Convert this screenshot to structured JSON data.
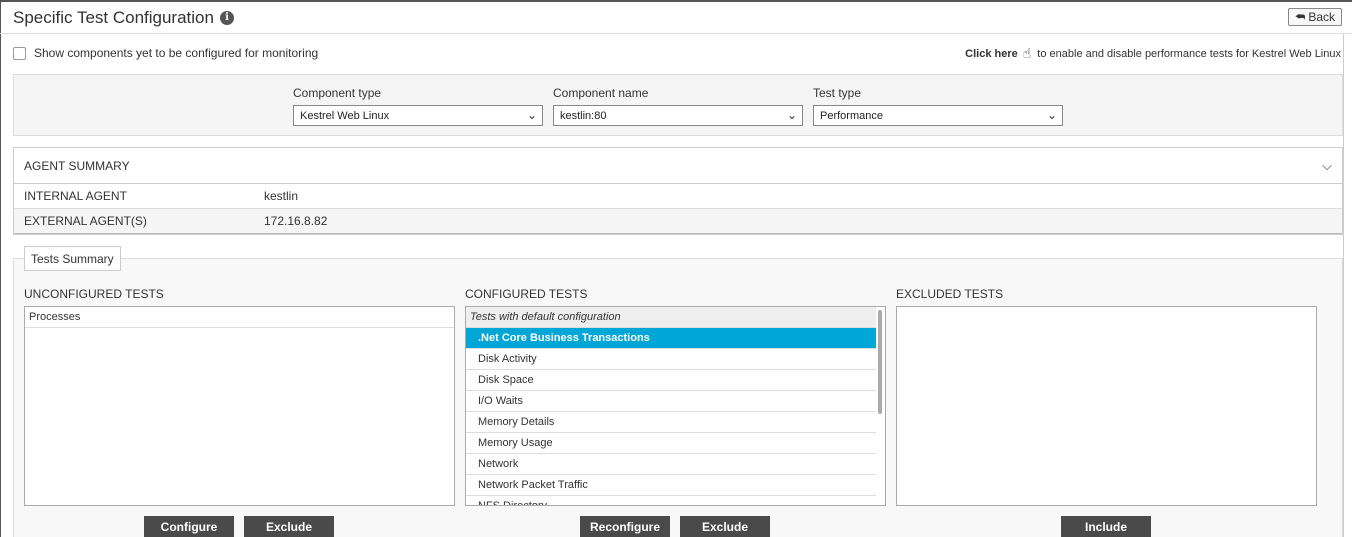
{
  "header": {
    "title": "Specific Test Configuration",
    "back_label": "Back"
  },
  "options": {
    "show_unconfigured_label": "Show components yet to be configured for monitoring",
    "click_here_label": "Click here",
    "click_here_text": "to enable and disable performance tests for Kestrel Web Linux"
  },
  "filters": {
    "component_type": {
      "label": "Component type",
      "value": "Kestrel Web Linux"
    },
    "component_name": {
      "label": "Component name",
      "value": "kestlin:80"
    },
    "test_type": {
      "label": "Test type",
      "value": "Performance"
    }
  },
  "agent_summary": {
    "title": "AGENT SUMMARY",
    "rows": [
      {
        "key": "INTERNAL AGENT",
        "value": "kestlin"
      },
      {
        "key": "EXTERNAL AGENT(S)",
        "value": "172.16.8.82"
      }
    ]
  },
  "tests_summary": {
    "tab_label": "Tests Summary",
    "unconfigured": {
      "label": "UNCONFIGURED TESTS",
      "items": [
        "Processes"
      ],
      "buttons": [
        "Configure",
        "Exclude"
      ]
    },
    "configured": {
      "label": "CONFIGURED TESTS",
      "group_label": "Tests with default configuration",
      "items": [
        ".Net Core Business Transactions",
        "Disk Activity",
        "Disk Space",
        "I/O Waits",
        "Memory Details",
        "Memory Usage",
        "Network",
        "Network Packet Traffic",
        "NFS Directory"
      ],
      "selected_index": 0,
      "buttons": [
        "Reconfigure",
        "Exclude"
      ]
    },
    "excluded": {
      "label": "EXCLUDED TESTS",
      "items": [],
      "buttons": [
        "Include"
      ]
    }
  },
  "icons": {
    "info": "info-icon",
    "back": "back-arrow-icon",
    "hand": "hand-pointer-icon",
    "chevron": "chevron-down-icon"
  },
  "colors": {
    "selected": "#00a6d6",
    "button": "#4a4a4a"
  }
}
